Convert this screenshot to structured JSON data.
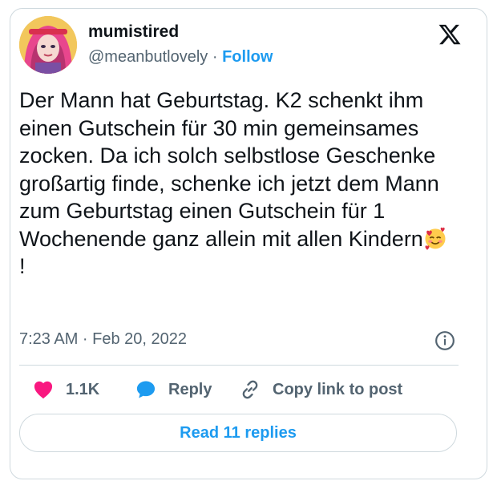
{
  "author": {
    "display_name": "mumistired",
    "handle": "@meanbutlovely",
    "separator": "·",
    "follow_label": "Follow",
    "avatar_icon": "avatar-illustration"
  },
  "logo_icon": "x-logo-icon",
  "tweet": {
    "text": "Der Mann hat Geburtstag. K2 schenkt ihm einen Gutschein für 30 min gemeinsames zocken. Da ich solch selbstlose Geschenke großartig finde, schenke ich jetzt dem Mann zum Geburtstag einen Gutschein für 1 Wochenende ganz allein mit allen Kindern",
    "emoji": "smiling-face-with-hearts",
    "trailing": "!",
    "timestamp": "7:23 AM · Feb 20, 2022"
  },
  "actions": {
    "like_count": "1.1K",
    "reply_label": "Reply",
    "copy_link_label": "Copy link to post"
  },
  "read_replies_label": "Read 11 replies",
  "colors": {
    "accent": "#1d9bf0",
    "heart": "#f91880",
    "text": "#0f1419",
    "muted": "#536471",
    "border": "#cfd9de"
  }
}
